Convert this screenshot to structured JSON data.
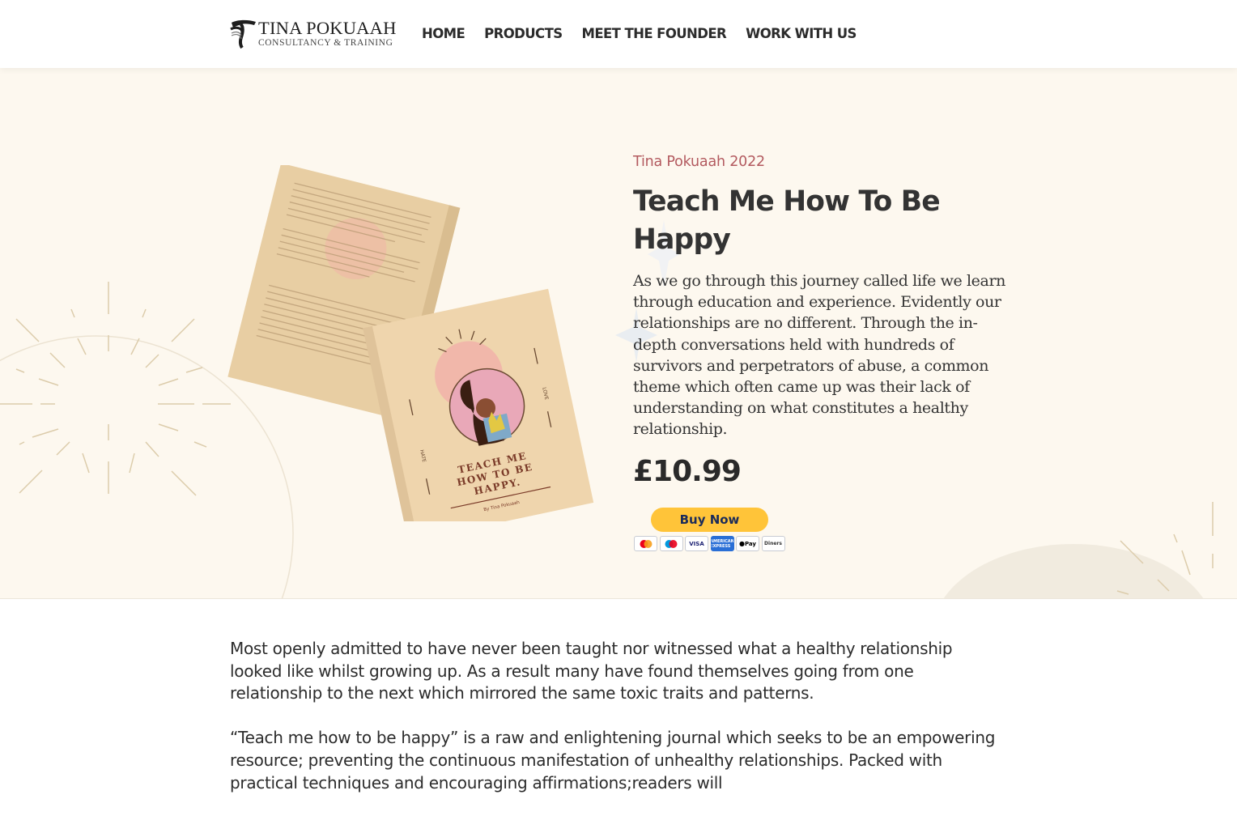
{
  "brand": {
    "name": "TINA POKUAAH",
    "tagline": "CONSULTANCY & TRAINING",
    "logo_icon": "tp-monogram-icon"
  },
  "nav": {
    "items": [
      {
        "label": "HOME"
      },
      {
        "label": "PRODUCTS"
      },
      {
        "label": "MEET THE FOUNDER"
      },
      {
        "label": "WORK WITH US"
      }
    ]
  },
  "product": {
    "subtitle": "Tina Pokuaah 2022",
    "title": "Teach Me How To Be Happy",
    "description": "As we go through this journey called life we learn through education and experience. Evidently our relationships are no different. Through the in-depth conversations held with hundreds of survivors and perpetrators of abuse, a common theme which often came up was their lack of understanding on what constitutes a healthy relationship.",
    "price": "£10.99",
    "buy_label": "Buy Now",
    "payment_methods": [
      {
        "name": "mastercard-icon",
        "label": ""
      },
      {
        "name": "maestro-icon",
        "label": ""
      },
      {
        "name": "visa-icon",
        "label": "VISA"
      },
      {
        "name": "amex-icon",
        "label": "AMERICAN EXPRESS"
      },
      {
        "name": "apple-pay-icon",
        "label": "Pay"
      },
      {
        "name": "diners-club-icon",
        "label": "Diners"
      }
    ],
    "book": {
      "cover_title": "TEACH ME HOW TO BE HAPPY.",
      "cover_author": "By Tina Pokuaah",
      "side_left": "HATE",
      "side_right": "LOVE"
    }
  },
  "body": {
    "paragraphs": [
      "Most openly admitted to have never been taught nor witnessed what a healthy relationship looked like whilst growing up. As a result many have found themselves going from one relationship to the next which mirrored the same toxic traits and patterns.",
      "“Teach me how to be happy” is a raw and enlightening journal which seeks to be an empowering resource; preventing the continuous manifestation of unhealthy relationships. Packed with practical techniques and encouraging affirmations;readers will"
    ]
  },
  "colors": {
    "hero_bg": "#fdf8ef",
    "accent": "#b35a5f",
    "button": "#ffc439",
    "book": "#efd5ad"
  }
}
